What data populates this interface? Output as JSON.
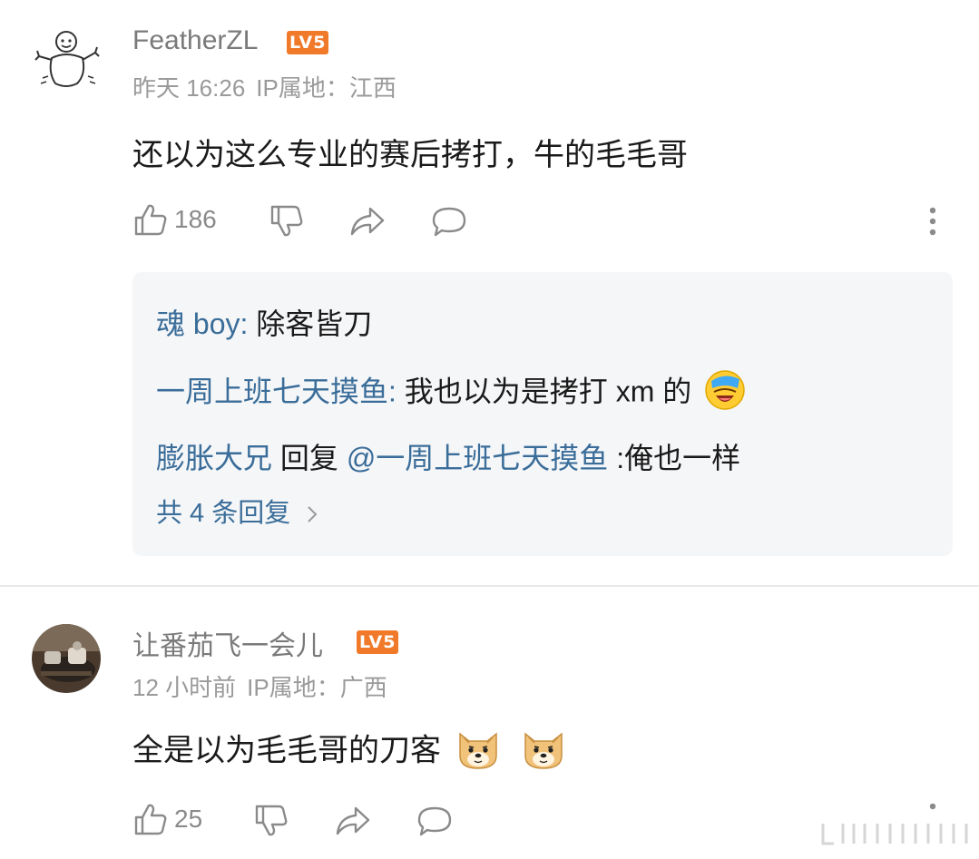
{
  "comments": [
    {
      "username": "FeatherZL",
      "level": "LV5",
      "time": "昨天 16:26",
      "ip": "IP属地：江西",
      "text": "还以为这么专业的赛后拷打，牛的毛毛哥",
      "likes": "186",
      "replies": [
        {
          "user": "魂 boy",
          "sep": ": ",
          "text": "除客皆刀"
        },
        {
          "user": "一周上班七天摸鱼",
          "sep": ": ",
          "text": "我也以为是拷打 xm 的",
          "emoji": "laugh-cry-emoji"
        },
        {
          "user": "膨胀大兄",
          "mid": " 回复 ",
          "target": "@一周上班七天摸鱼",
          "text": " :俺也一样"
        }
      ],
      "see_more": "共 4 条回复"
    },
    {
      "username": "让番茄飞一会儿",
      "level": "LV5",
      "time": "12 小时前",
      "ip": "IP属地：广西",
      "text": "全是以为毛毛哥的刀客",
      "emojis": [
        "doge-emoji",
        "doge-emoji"
      ],
      "likes": "25"
    }
  ],
  "colors": {
    "link": "#3a6d99",
    "level_badge": "#f07a2a",
    "meta": "#9a9a9a",
    "reply_bg": "#f5f6f8"
  }
}
